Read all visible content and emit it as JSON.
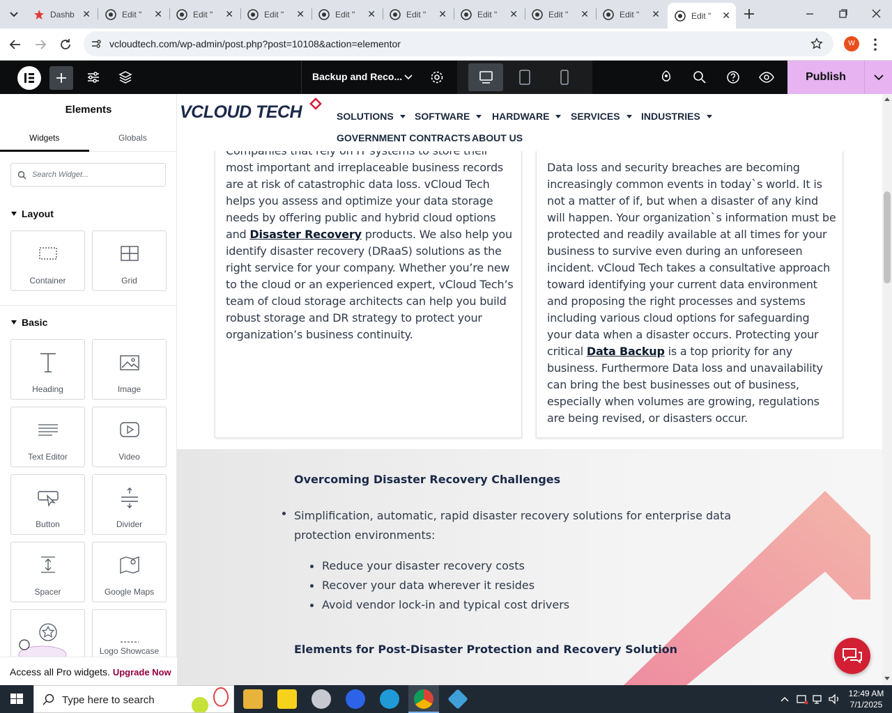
{
  "browser": {
    "tabs": [
      {
        "label": "Dashb",
        "icon": "wp-dashboard-icon"
      },
      {
        "label": "Edit \"",
        "icon": "wordpress-icon"
      },
      {
        "label": "Edit \"",
        "icon": "wordpress-icon"
      },
      {
        "label": "Edit \"",
        "icon": "wordpress-icon"
      },
      {
        "label": "Edit \"",
        "icon": "wordpress-icon"
      },
      {
        "label": "Edit \"",
        "icon": "wordpress-icon"
      },
      {
        "label": "Edit \"",
        "icon": "wordpress-icon"
      },
      {
        "label": "Edit \"",
        "icon": "wordpress-icon"
      },
      {
        "label": "Edit \"",
        "icon": "wordpress-icon"
      },
      {
        "label": "Edit \"",
        "icon": "wordpress-icon"
      }
    ],
    "url": "vcloudtech.com/wp-admin/post.php?post=10108&action=elementor",
    "profile_initial": "W"
  },
  "editor": {
    "document_title": "Backup and Reco...",
    "publish_label": "Publish"
  },
  "sidebar": {
    "title": "Elements",
    "tabs": [
      "Widgets",
      "Globals"
    ],
    "search_placeholder": "Search Widget...",
    "sections": {
      "layout": "Layout",
      "basic": "Basic"
    },
    "layout_widgets": [
      "Container",
      "Grid"
    ],
    "basic_widgets": [
      "Heading",
      "Image",
      "Text Editor",
      "Video",
      "Button",
      "Divider",
      "Spacer",
      "Google Maps",
      "",
      "Logo Showcase"
    ],
    "promo_text": "Access all Pro widgets.",
    "promo_link": "Upgrade Now"
  },
  "site": {
    "logo_text": "VCLOUD TECH",
    "nav": [
      "SOLUTIONS",
      "SOFTWARE",
      "HARDWARE",
      "SERVICES",
      "INDUSTRIES",
      "GOVERNMENT CONTRACTS",
      "ABOUT US"
    ],
    "left_card": {
      "line0": "Companies that rely on IT systems to store their",
      "line1": "most important and irreplaceable business records",
      "line2": "are at risk of catastrophic data loss. vCloud Tech",
      "line3": "helps you assess and optimize your data storage",
      "line4": "needs by offering public and hybrid cloud options",
      "line5a": "and ",
      "line5_link": "Disaster Recovery",
      "line5b": " products. We also help you",
      "line6": "identify disaster recovery (DRaaS) solutions as the",
      "line7": "right service for your company. Whether you’re new",
      "line8": "to the cloud or an experienced expert, vCloud Tech’s",
      "line9": "team of cloud storage architects can help you build",
      "line10": "robust storage and DR strategy to protect your",
      "line11": "organization’s business continuity."
    },
    "right_card": {
      "line1": "Data loss and security breaches are becoming",
      "line2": "increasingly common events in today`s world. It is",
      "line3": "not a matter of if, but when a disaster of any kind",
      "line4": "will happen. Your organization`s information must be",
      "line5": "protected and readily available at all times for your",
      "line6": "business to survive even during an unforeseen",
      "line7": "incident. vCloud Tech takes a consultative approach",
      "line8": "toward identifying your current data environment",
      "line9": "and proposing the right processes and systems",
      "line10": "including various cloud options for safeguarding",
      "line11": "your data when a disaster occurs. Protecting your",
      "line12a": "critical ",
      "line12_link": "Data Backup",
      "line12b": " is a top priority for any",
      "line13": "business. Furthermore Data loss and unavailability",
      "line14": "can bring the best businesses out of business,",
      "line15": "especially when volumes are growing, regulations",
      "line16": "are being revised, or disasters occur."
    },
    "challenges": {
      "heading": "Overcoming Disaster Recovery Challenges",
      "intro1": "Simplification, automatic, rapid disaster recovery solutions for enterprise data",
      "intro2": "protection environments:",
      "bullets": [
        "Reduce your disaster recovery costs",
        "Recover your data wherever it resides",
        "Avoid vendor lock-in and typical cost drivers"
      ],
      "heading2": "Elements for Post-Disaster Protection and Recovery Solution"
    }
  },
  "taskbar": {
    "search_placeholder": "Type here to search",
    "time": "12:49 AM",
    "date": "7/1/2025"
  },
  "colors": {
    "accent_publish": "#e7b3f0",
    "brand_red": "#d31f34",
    "navy": "#1b2a3d"
  }
}
